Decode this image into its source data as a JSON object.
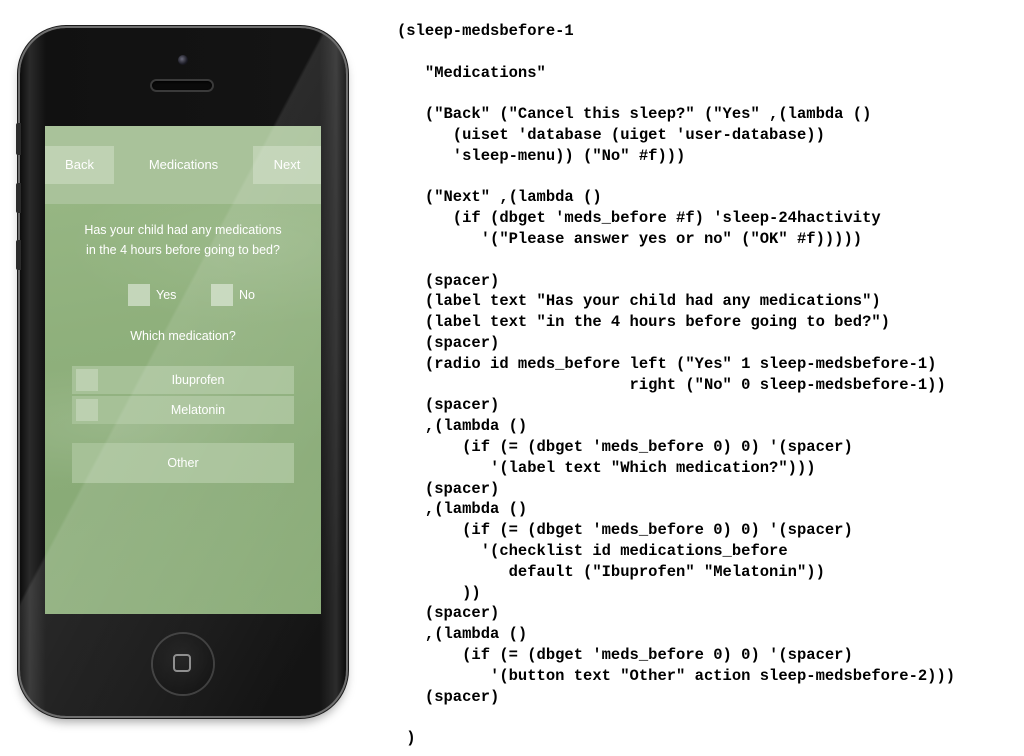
{
  "app": {
    "header": {
      "back_label": "Back",
      "title": "Medications",
      "next_label": "Next"
    },
    "question": {
      "line1": "Has your child had any medications",
      "line2": "in the 4 hours before going to bed?"
    },
    "radio": {
      "yes_label": "Yes",
      "no_label": "No"
    },
    "which_label": "Which medication?",
    "checklist": [
      {
        "label": "Ibuprofen"
      },
      {
        "label": "Melatonin"
      }
    ],
    "other_label": "Other"
  },
  "code_lines": [
    "(sleep-medsbefore-1",
    "",
    "   \"Medications\"",
    "",
    "   (\"Back\" (\"Cancel this sleep?\" (\"Yes\" ,(lambda ()",
    "      (uiset 'database (uiget 'user-database))",
    "      'sleep-menu)) (\"No\" #f)))",
    "",
    "   (\"Next\" ,(lambda ()",
    "      (if (dbget 'meds_before #f) 'sleep-24hactivity",
    "         '(\"Please answer yes or no\" (\"OK\" #f)))))",
    "",
    "   (spacer)",
    "   (label text \"Has your child had any medications\")",
    "   (label text \"in the 4 hours before going to bed?\")",
    "   (spacer)",
    "   (radio id meds_before left (\"Yes\" 1 sleep-medsbefore-1)",
    "                         right (\"No\" 0 sleep-medsbefore-1))",
    "   (spacer)",
    "   ,(lambda ()",
    "       (if (= (dbget 'meds_before 0) 0) '(spacer)",
    "          '(label text \"Which medication?\")))",
    "   (spacer)",
    "   ,(lambda ()",
    "       (if (= (dbget 'meds_before 0) 0) '(spacer)",
    "         '(checklist id medications_before",
    "            default (\"Ibuprofen\" \"Melatonin\"))",
    "       ))",
    "   (spacer)",
    "   ,(lambda ()",
    "       (if (= (dbget 'meds_before 0) 0) '(spacer)",
    "          '(button text \"Other\" action sleep-medsbefore-2)))",
    "   (spacer)",
    "",
    " )"
  ]
}
